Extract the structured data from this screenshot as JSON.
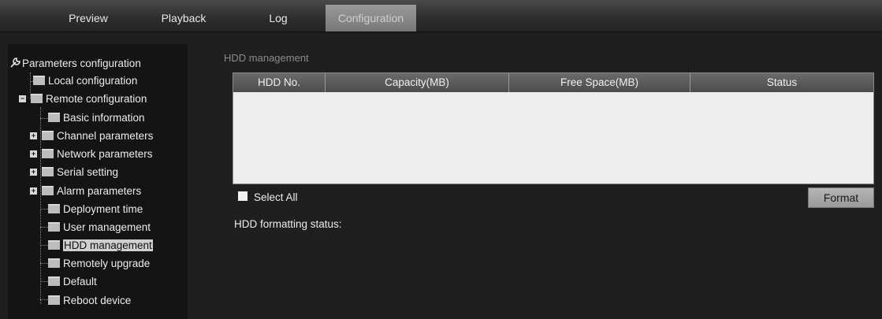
{
  "nav": {
    "tabs": [
      {
        "label": "Preview"
      },
      {
        "label": "Playback"
      },
      {
        "label": "Log"
      },
      {
        "label": "Configuration",
        "active": true
      }
    ]
  },
  "sidebar": {
    "root": {
      "label": "Parameters configuration",
      "icon": "settings-tool-icon"
    },
    "items": [
      {
        "label": "Local configuration",
        "icon": "folder-icon"
      },
      {
        "label": "Remote configuration",
        "icon": "folder-icon",
        "expander": "collapse-icon"
      },
      {
        "label": "Basic information",
        "icon": "folder-icon"
      },
      {
        "label": "Channel parameters",
        "icon": "folder-icon",
        "expander": "expand-icon"
      },
      {
        "label": "Network parameters",
        "icon": "folder-icon",
        "expander": "expand-icon"
      },
      {
        "label": "Serial setting",
        "icon": "folder-icon",
        "expander": "expand-icon"
      },
      {
        "label": "Alarm parameters",
        "icon": "folder-icon",
        "expander": "expand-icon"
      },
      {
        "label": "Deployment time",
        "icon": "folder-icon"
      },
      {
        "label": "User management",
        "icon": "folder-icon"
      },
      {
        "label": "HDD management",
        "icon": "folder-icon",
        "selected": true
      },
      {
        "label": "Remotely upgrade",
        "icon": "folder-icon"
      },
      {
        "label": "Default",
        "icon": "folder-icon"
      },
      {
        "label": "Reboot device",
        "icon": "folder-icon"
      }
    ]
  },
  "main": {
    "title": "HDD management",
    "table": {
      "columns": [
        "HDD No.",
        "Capacity(MB)",
        "Free Space(MB)",
        "Status"
      ],
      "rows": []
    },
    "select_all_label": "Select All",
    "format_button": "Format",
    "formatting_status_label": "HDD formatting status:"
  },
  "colors": {
    "background": "#1f1f1f",
    "sidebar": "#141414",
    "active_tab": "#8a8a8a",
    "table_body": "#eeeeee"
  }
}
